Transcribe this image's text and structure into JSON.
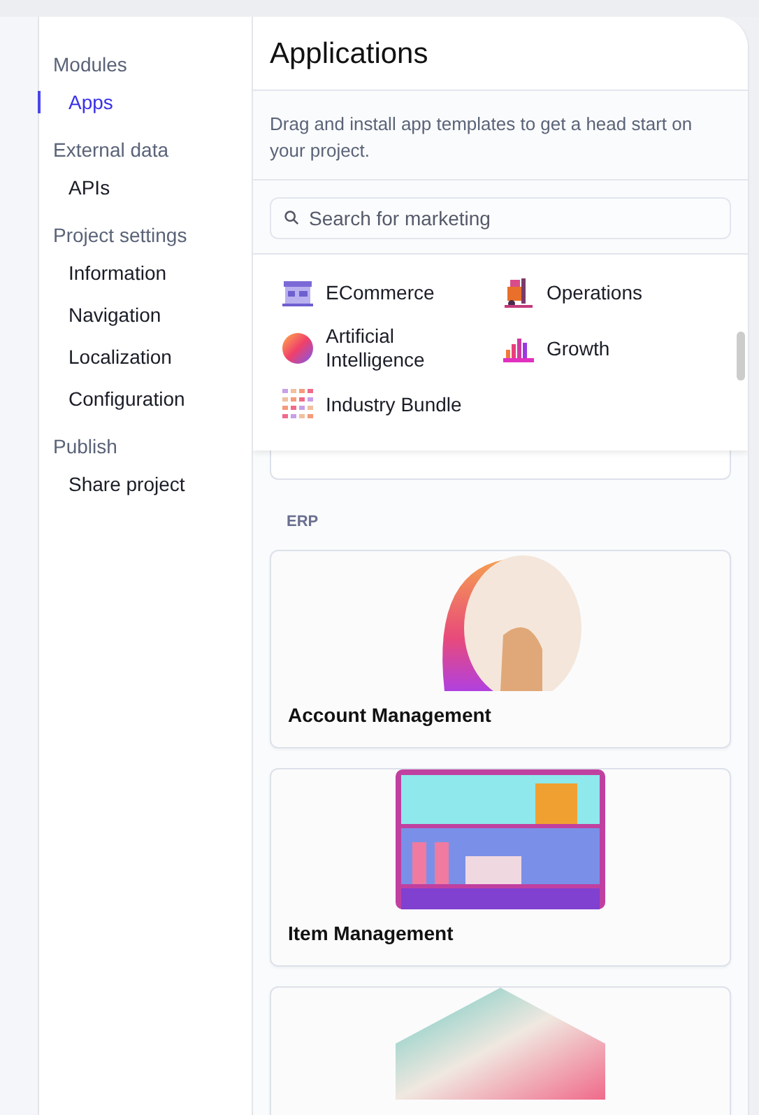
{
  "sidebar": {
    "sections": [
      {
        "title": "Modules",
        "items": [
          {
            "label": "Apps",
            "selected": true
          }
        ]
      },
      {
        "title": "External data",
        "items": [
          {
            "label": "APIs",
            "selected": false
          }
        ]
      },
      {
        "title": "Project settings",
        "items": [
          {
            "label": "Information",
            "selected": false
          },
          {
            "label": "Navigation",
            "selected": false
          },
          {
            "label": "Localization",
            "selected": false
          },
          {
            "label": "Configuration",
            "selected": false
          }
        ]
      },
      {
        "title": "Publish",
        "items": [
          {
            "label": "Share project",
            "selected": false
          }
        ]
      }
    ]
  },
  "main": {
    "title": "Applications",
    "description": "Drag and install app templates to get a head start on your project.",
    "search": {
      "placeholder": "Search for marketing"
    },
    "categories": [
      {
        "label": "ECommerce",
        "kind": "store"
      },
      {
        "label": "Operations",
        "kind": "forklift"
      },
      {
        "label": "Artificial Intelligence",
        "kind": "sphere"
      },
      {
        "label": "Growth",
        "kind": "bars"
      },
      {
        "label": "Industry Bundle",
        "kind": "grid"
      }
    ],
    "section": "ERP",
    "cards": [
      {
        "title": "Account Management",
        "kind": "dial"
      },
      {
        "title": "Item Management",
        "kind": "shelf"
      },
      {
        "kind": "papers"
      }
    ]
  }
}
